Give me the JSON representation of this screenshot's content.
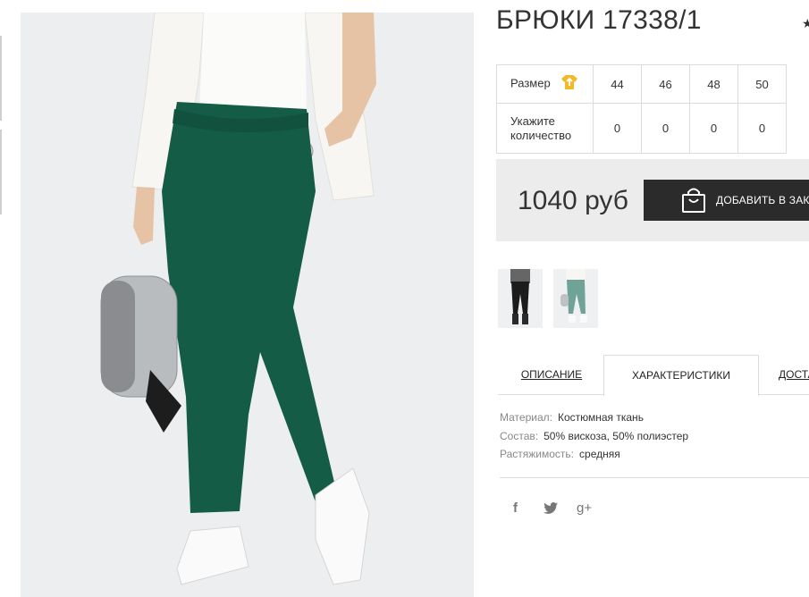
{
  "product": {
    "title": "БРЮКИ 17338/1",
    "favorite_icon": "★"
  },
  "size_table": {
    "size_label": "Размер",
    "size_icon": "t-shirt-icon",
    "qty_label_line1": "Укажите",
    "qty_label_line2": "количество",
    "sizes": [
      "44",
      "46",
      "48",
      "50"
    ],
    "quantities": [
      "0",
      "0",
      "0",
      "0"
    ]
  },
  "purchase": {
    "price": "1040 руб",
    "add_to_cart": "ДОБАВИТЬ В ЗАКАЗ"
  },
  "tabs": {
    "description": "ОПИСАНИЕ",
    "characteristics": "ХАРАКТЕРИСТИКИ",
    "delivery": "ДОСТАВКА"
  },
  "specs": [
    {
      "key": "Материал:",
      "value": "Костюмная ткань"
    },
    {
      "key": "Состав:",
      "value": "50% вискоза, 50% полиэстер"
    },
    {
      "key": "Растяжимость:",
      "value": "средняя"
    }
  ],
  "social": {
    "facebook": "f",
    "twitter": "twitter-icon",
    "google_plus": "g+"
  },
  "colors": {
    "pants_green": "#145c46",
    "button_dark": "#2b2b2b",
    "price_bg": "#ececec"
  }
}
